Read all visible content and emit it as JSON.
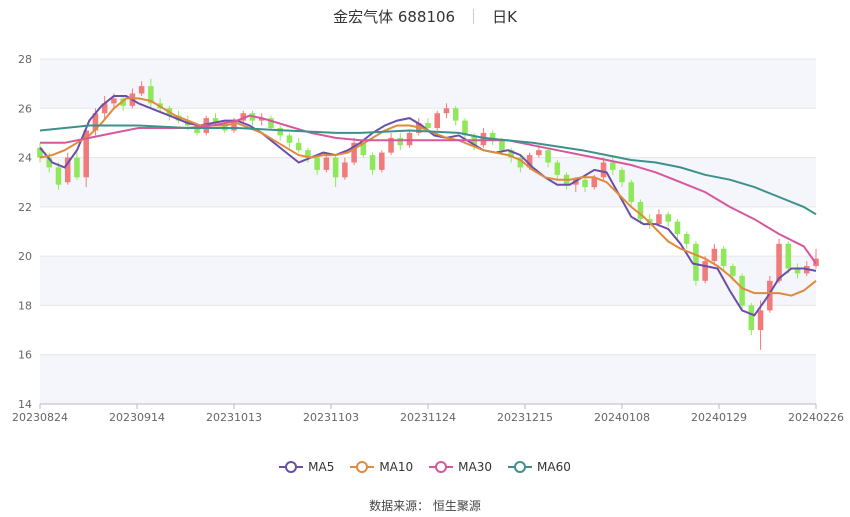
{
  "header": {
    "stock_name": "金宏气体 688106",
    "period_label": "日K"
  },
  "source": {
    "text": "数据来源：  恒生聚源"
  },
  "chart_data": {
    "type": "candlestick",
    "ylim": [
      14,
      28
    ],
    "yticks": [
      14,
      16,
      18,
      20,
      22,
      24,
      26,
      28
    ],
    "xticks": [
      "20230824",
      "20230914",
      "20231013",
      "20231103",
      "20231124",
      "20231215",
      "20240108",
      "20240129",
      "20240226"
    ],
    "up_color": "#f07b7b",
    "down_color": "#8ee85a",
    "grid": true,
    "legend_position": "bottom",
    "series": [
      {
        "name": "MA5",
        "color": "#6a4ea8",
        "points": [
          [
            0,
            24.4
          ],
          [
            4,
            23.8
          ],
          [
            8,
            23.6
          ],
          [
            12,
            24.3
          ],
          [
            16,
            25.5
          ],
          [
            20,
            26.1
          ],
          [
            24,
            26.5
          ],
          [
            28,
            26.5
          ],
          [
            32,
            26.2
          ],
          [
            36,
            26.0
          ],
          [
            40,
            25.8
          ],
          [
            44,
            25.6
          ],
          [
            48,
            25.4
          ],
          [
            52,
            25.3
          ],
          [
            56,
            25.4
          ],
          [
            60,
            25.5
          ],
          [
            64,
            25.5
          ],
          [
            68,
            25.3
          ],
          [
            72,
            25.0
          ],
          [
            76,
            24.6
          ],
          [
            80,
            24.2
          ],
          [
            84,
            23.8
          ],
          [
            88,
            24.0
          ],
          [
            92,
            24.2
          ],
          [
            96,
            24.1
          ],
          [
            100,
            24.3
          ],
          [
            104,
            24.6
          ],
          [
            108,
            25.0
          ],
          [
            112,
            25.3
          ],
          [
            116,
            25.5
          ],
          [
            120,
            25.6
          ],
          [
            124,
            25.3
          ],
          [
            128,
            24.9
          ],
          [
            132,
            24.8
          ],
          [
            136,
            24.9
          ],
          [
            140,
            24.6
          ],
          [
            144,
            24.3
          ],
          [
            148,
            24.2
          ],
          [
            152,
            24.3
          ],
          [
            156,
            24.1
          ],
          [
            160,
            23.6
          ],
          [
            164,
            23.2
          ],
          [
            168,
            22.9
          ],
          [
            172,
            22.9
          ],
          [
            176,
            23.2
          ],
          [
            180,
            23.5
          ],
          [
            184,
            23.4
          ],
          [
            188,
            22.5
          ],
          [
            192,
            21.6
          ],
          [
            196,
            21.3
          ],
          [
            200,
            21.3
          ],
          [
            204,
            21.1
          ],
          [
            208,
            20.5
          ],
          [
            212,
            19.7
          ],
          [
            216,
            19.6
          ],
          [
            220,
            19.5
          ],
          [
            224,
            18.6
          ],
          [
            228,
            17.8
          ],
          [
            232,
            17.6
          ],
          [
            236,
            18.3
          ],
          [
            240,
            19.1
          ],
          [
            244,
            19.5
          ],
          [
            248,
            19.5
          ],
          [
            252,
            19.4
          ]
        ]
      },
      {
        "name": "MA10",
        "color": "#e08a3c",
        "points": [
          [
            0,
            24.0
          ],
          [
            4,
            24.1
          ],
          [
            8,
            24.3
          ],
          [
            12,
            24.6
          ],
          [
            16,
            24.9
          ],
          [
            20,
            25.4
          ],
          [
            24,
            26.0
          ],
          [
            28,
            26.4
          ],
          [
            32,
            26.4
          ],
          [
            36,
            26.3
          ],
          [
            40,
            26.0
          ],
          [
            44,
            25.7
          ],
          [
            48,
            25.5
          ],
          [
            52,
            25.3
          ],
          [
            56,
            25.3
          ],
          [
            60,
            25.3
          ],
          [
            64,
            25.4
          ],
          [
            68,
            25.2
          ],
          [
            72,
            25.0
          ],
          [
            76,
            24.7
          ],
          [
            80,
            24.4
          ],
          [
            84,
            24.1
          ],
          [
            88,
            24.0
          ],
          [
            92,
            24.1
          ],
          [
            96,
            24.1
          ],
          [
            100,
            24.2
          ],
          [
            104,
            24.5
          ],
          [
            108,
            24.8
          ],
          [
            112,
            25.1
          ],
          [
            116,
            25.3
          ],
          [
            120,
            25.3
          ],
          [
            124,
            25.2
          ],
          [
            128,
            25.0
          ],
          [
            132,
            24.8
          ],
          [
            136,
            24.7
          ],
          [
            140,
            24.5
          ],
          [
            144,
            24.3
          ],
          [
            148,
            24.2
          ],
          [
            152,
            24.1
          ],
          [
            156,
            23.9
          ],
          [
            160,
            23.5
          ],
          [
            164,
            23.2
          ],
          [
            168,
            23.1
          ],
          [
            172,
            23.1
          ],
          [
            176,
            23.2
          ],
          [
            180,
            23.2
          ],
          [
            184,
            23.0
          ],
          [
            188,
            22.5
          ],
          [
            192,
            22.0
          ],
          [
            196,
            21.6
          ],
          [
            200,
            21.1
          ],
          [
            204,
            20.6
          ],
          [
            208,
            20.3
          ],
          [
            212,
            20.1
          ],
          [
            216,
            19.9
          ],
          [
            220,
            19.6
          ],
          [
            224,
            19.2
          ],
          [
            228,
            18.7
          ],
          [
            232,
            18.5
          ],
          [
            236,
            18.5
          ],
          [
            240,
            18.5
          ],
          [
            244,
            18.4
          ],
          [
            248,
            18.6
          ],
          [
            252,
            19.0
          ]
        ]
      },
      {
        "name": "MA30",
        "color": "#d6589c",
        "points": [
          [
            0,
            24.6
          ],
          [
            8,
            24.6
          ],
          [
            16,
            24.8
          ],
          [
            24,
            25.0
          ],
          [
            32,
            25.2
          ],
          [
            40,
            25.2
          ],
          [
            48,
            25.2
          ],
          [
            56,
            25.3
          ],
          [
            64,
            25.5
          ],
          [
            68,
            25.7
          ],
          [
            72,
            25.6
          ],
          [
            80,
            25.3
          ],
          [
            88,
            25.0
          ],
          [
            96,
            24.8
          ],
          [
            104,
            24.7
          ],
          [
            112,
            24.7
          ],
          [
            120,
            24.7
          ],
          [
            128,
            24.7
          ],
          [
            136,
            24.7
          ],
          [
            144,
            24.7
          ],
          [
            152,
            24.7
          ],
          [
            160,
            24.5
          ],
          [
            168,
            24.3
          ],
          [
            176,
            24.1
          ],
          [
            184,
            23.9
          ],
          [
            192,
            23.7
          ],
          [
            200,
            23.4
          ],
          [
            208,
            23.0
          ],
          [
            216,
            22.6
          ],
          [
            224,
            22.0
          ],
          [
            232,
            21.5
          ],
          [
            240,
            20.9
          ],
          [
            248,
            20.4
          ],
          [
            252,
            19.7
          ]
        ]
      },
      {
        "name": "MA60",
        "color": "#3d918c",
        "points": [
          [
            0,
            25.1
          ],
          [
            16,
            25.3
          ],
          [
            32,
            25.3
          ],
          [
            48,
            25.2
          ],
          [
            64,
            25.2
          ],
          [
            80,
            25.1
          ],
          [
            96,
            25.0
          ],
          [
            104,
            25.0
          ],
          [
            120,
            25.1
          ],
          [
            136,
            25.0
          ],
          [
            144,
            24.8
          ],
          [
            160,
            24.6
          ],
          [
            176,
            24.3
          ],
          [
            184,
            24.1
          ],
          [
            192,
            23.9
          ],
          [
            200,
            23.8
          ],
          [
            208,
            23.6
          ],
          [
            216,
            23.3
          ],
          [
            224,
            23.1
          ],
          [
            232,
            22.8
          ],
          [
            240,
            22.4
          ],
          [
            248,
            22.0
          ],
          [
            252,
            21.7
          ]
        ]
      }
    ],
    "candles": [
      [
        0,
        24.4,
        24.0,
        24.6,
        23.8
      ],
      [
        1,
        24.0,
        23.6,
        24.2,
        23.4
      ],
      [
        2,
        23.6,
        22.9,
        23.8,
        22.7
      ],
      [
        3,
        23.0,
        24.0,
        24.2,
        22.9
      ],
      [
        4,
        24.0,
        23.2,
        24.2,
        23.1
      ],
      [
        5,
        23.2,
        25.1,
        25.3,
        22.8
      ],
      [
        6,
        25.1,
        25.8,
        26.0,
        24.9
      ],
      [
        7,
        25.8,
        26.2,
        26.5,
        25.6
      ],
      [
        8,
        26.2,
        26.4,
        26.6,
        26.0
      ],
      [
        9,
        26.4,
        26.1,
        26.5,
        25.9
      ],
      [
        10,
        26.1,
        26.6,
        26.8,
        26.0
      ],
      [
        11,
        26.6,
        26.9,
        27.1,
        26.5
      ],
      [
        12,
        26.9,
        26.2,
        27.2,
        26.0
      ],
      [
        13,
        26.2,
        26.0,
        26.4,
        25.8
      ],
      [
        14,
        26.0,
        25.7,
        26.1,
        25.5
      ],
      [
        15,
        25.7,
        25.5,
        25.9,
        25.4
      ],
      [
        16,
        25.5,
        25.3,
        25.7,
        25.1
      ],
      [
        17,
        25.3,
        25.0,
        25.4,
        24.9
      ],
      [
        18,
        25.0,
        25.6,
        25.7,
        24.9
      ],
      [
        19,
        25.6,
        25.4,
        25.8,
        25.3
      ],
      [
        20,
        25.4,
        25.1,
        25.5,
        25.0
      ],
      [
        21,
        25.1,
        25.5,
        25.6,
        25.0
      ],
      [
        22,
        25.5,
        25.8,
        25.9,
        25.4
      ],
      [
        23,
        25.8,
        25.5,
        25.9,
        25.3
      ],
      [
        24,
        25.5,
        25.6,
        25.8,
        25.3
      ],
      [
        25,
        25.6,
        25.2,
        25.7,
        25.1
      ],
      [
        26,
        25.2,
        24.9,
        25.3,
        24.7
      ],
      [
        27,
        24.9,
        24.6,
        25.0,
        24.4
      ],
      [
        28,
        24.6,
        24.3,
        24.8,
        24.2
      ],
      [
        29,
        24.3,
        24.0,
        24.4,
        23.8
      ],
      [
        30,
        24.0,
        23.5,
        24.1,
        23.3
      ],
      [
        31,
        23.5,
        24.0,
        24.2,
        23.4
      ],
      [
        32,
        24.0,
        23.2,
        24.1,
        22.8
      ],
      [
        33,
        23.2,
        23.8,
        24.0,
        23.1
      ],
      [
        34,
        23.8,
        24.6,
        24.8,
        23.7
      ],
      [
        35,
        24.6,
        24.1,
        24.7,
        24.0
      ],
      [
        36,
        24.1,
        23.5,
        24.2,
        23.3
      ],
      [
        37,
        23.5,
        24.2,
        24.3,
        23.4
      ],
      [
        38,
        24.2,
        24.8,
        25.0,
        24.1
      ],
      [
        39,
        24.8,
        24.5,
        25.0,
        24.3
      ],
      [
        40,
        24.5,
        25.0,
        25.1,
        24.4
      ],
      [
        41,
        25.0,
        25.4,
        25.6,
        24.9
      ],
      [
        42,
        25.4,
        25.2,
        25.6,
        25.1
      ],
      [
        43,
        25.2,
        25.8,
        25.9,
        25.1
      ],
      [
        44,
        25.8,
        26.0,
        26.2,
        25.6
      ],
      [
        45,
        26.0,
        25.5,
        26.1,
        25.3
      ],
      [
        46,
        25.5,
        24.9,
        25.6,
        24.8
      ],
      [
        47,
        24.9,
        24.5,
        25.0,
        24.3
      ],
      [
        48,
        24.5,
        25.0,
        25.2,
        24.4
      ],
      [
        49,
        25.0,
        24.7,
        25.1,
        24.5
      ],
      [
        50,
        24.7,
        24.3,
        24.8,
        24.1
      ],
      [
        51,
        24.3,
        24.0,
        24.4,
        23.8
      ],
      [
        52,
        24.0,
        23.6,
        24.1,
        23.4
      ],
      [
        53,
        23.6,
        24.1,
        24.2,
        23.5
      ],
      [
        54,
        24.1,
        24.3,
        24.5,
        24.0
      ],
      [
        55,
        24.3,
        23.8,
        24.4,
        23.6
      ],
      [
        56,
        23.8,
        23.3,
        23.9,
        23.1
      ],
      [
        57,
        23.3,
        22.9,
        23.4,
        22.7
      ],
      [
        58,
        22.9,
        23.1,
        23.2,
        22.6
      ],
      [
        59,
        23.1,
        22.8,
        23.2,
        22.6
      ],
      [
        60,
        22.8,
        23.2,
        23.3,
        22.7
      ],
      [
        61,
        23.2,
        23.8,
        24.0,
        23.1
      ],
      [
        62,
        23.8,
        23.5,
        24.1,
        23.3
      ],
      [
        63,
        23.5,
        23.0,
        23.6,
        22.8
      ],
      [
        64,
        23.0,
        22.2,
        23.1,
        22.0
      ],
      [
        65,
        22.2,
        21.5,
        22.3,
        21.3
      ],
      [
        66,
        21.5,
        21.3,
        21.7,
        21.1
      ],
      [
        67,
        21.3,
        21.7,
        21.9,
        21.2
      ],
      [
        68,
        21.7,
        21.4,
        21.8,
        21.2
      ],
      [
        69,
        21.4,
        20.9,
        21.5,
        20.7
      ],
      [
        70,
        20.9,
        20.5,
        21.0,
        20.3
      ],
      [
        71,
        20.5,
        19.0,
        20.6,
        18.8
      ],
      [
        72,
        19.0,
        19.8,
        20.0,
        18.9
      ],
      [
        73,
        19.8,
        20.3,
        20.5,
        19.7
      ],
      [
        74,
        20.3,
        19.6,
        20.4,
        19.4
      ],
      [
        75,
        19.6,
        19.2,
        19.7,
        19.0
      ],
      [
        76,
        19.2,
        18.0,
        19.3,
        17.8
      ],
      [
        77,
        18.0,
        17.0,
        18.1,
        16.8
      ],
      [
        78,
        17.0,
        17.8,
        18.2,
        16.2
      ],
      [
        79,
        17.8,
        19.0,
        19.2,
        17.7
      ],
      [
        80,
        19.0,
        20.5,
        20.7,
        18.9
      ],
      [
        81,
        20.5,
        19.5,
        20.6,
        19.3
      ],
      [
        82,
        19.5,
        19.3,
        19.7,
        19.1
      ],
      [
        83,
        19.3,
        19.6,
        19.8,
        19.2
      ],
      [
        84,
        19.6,
        19.9,
        20.3,
        19.5
      ]
    ]
  }
}
